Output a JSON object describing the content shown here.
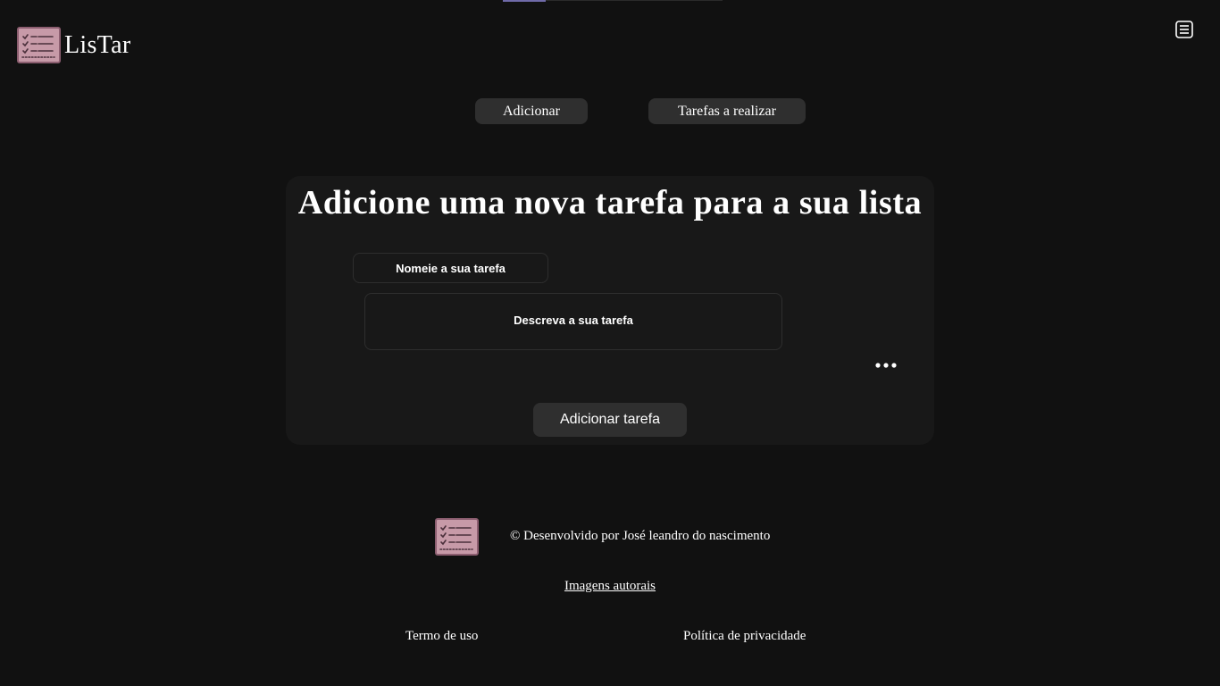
{
  "brand": {
    "name": "LisTar",
    "logo_icon": "checklist-icon",
    "accent_color": "#c79aa8"
  },
  "header": {
    "menu_icon": "hamburger-menu-icon"
  },
  "nav": {
    "add_label": "Adicionar",
    "tasks_label": "Tarefas a realizar"
  },
  "form": {
    "title": "Adicione uma nova tarefa para a sua lista",
    "name_placeholder": "Nomeie a sua tarefa",
    "description_placeholder": "Descreva a sua tarefa",
    "more_icon": "more-horizontal-icon",
    "submit_label": "Adicionar tarefa"
  },
  "footer": {
    "credit": "© Desenvolvido por José leandro do nascimento",
    "images_link": "Imagens autorais",
    "terms_link": "Termo de uso",
    "privacy_link": "Política de privacidade"
  },
  "colors": {
    "background": "#111111",
    "card": "#181818",
    "button": "#2f2f2f"
  }
}
